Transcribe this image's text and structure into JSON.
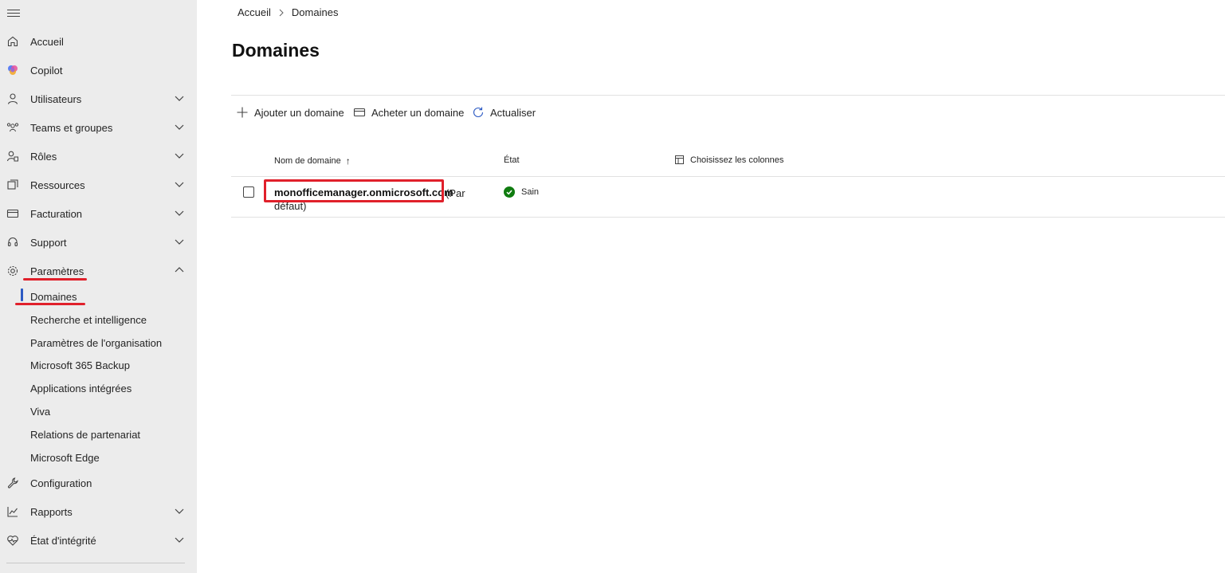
{
  "sidebar": {
    "items": [
      {
        "label": "Accueil",
        "icon": "home-icon"
      },
      {
        "label": "Copilot",
        "icon": "copilot-icon"
      },
      {
        "label": "Utilisateurs",
        "icon": "user-icon"
      },
      {
        "label": "Teams et groupes",
        "icon": "people-team-icon"
      },
      {
        "label": "Rôles",
        "icon": "role-icon"
      },
      {
        "label": "Ressources",
        "icon": "resources-icon"
      },
      {
        "label": "Facturation",
        "icon": "billing-icon"
      },
      {
        "label": "Support",
        "icon": "headset-icon"
      },
      {
        "label": "Paramètres",
        "icon": "gear-icon"
      }
    ],
    "settings_subitems": [
      "Domaines",
      "Recherche et intelligence",
      "Paramètres de l'organisation",
      "Microsoft 365 Backup",
      "Applications intégrées",
      "Viva",
      "Relations de partenariat",
      "Microsoft Edge"
    ],
    "bottom_items": [
      {
        "label": "Configuration",
        "icon": "wrench-icon"
      },
      {
        "label": "Rapports",
        "icon": "chart-icon"
      },
      {
        "label": "État d'intégrité",
        "icon": "heart-pulse-icon"
      }
    ],
    "accent_color": "#2b59c3"
  },
  "breadcrumb": {
    "home": "Accueil",
    "current": "Domaines"
  },
  "page_title": "Domaines",
  "toolbar": {
    "add_label": "Ajouter un domaine",
    "buy_label": "Acheter un domaine",
    "refresh_label": "Actualiser"
  },
  "table": {
    "columns": {
      "name": "Nom de domaine",
      "name_sort": "↑",
      "status": "État",
      "choose_columns": "Choisissez les colonnes"
    },
    "rows": [
      {
        "domain": "monofficemanager.onmicrosoft.com",
        "suffix_line1": "(Par",
        "suffix_line2": "défaut)",
        "status": "Sain",
        "status_color": "#107c10"
      }
    ]
  },
  "annotation_color": "#e0202b"
}
